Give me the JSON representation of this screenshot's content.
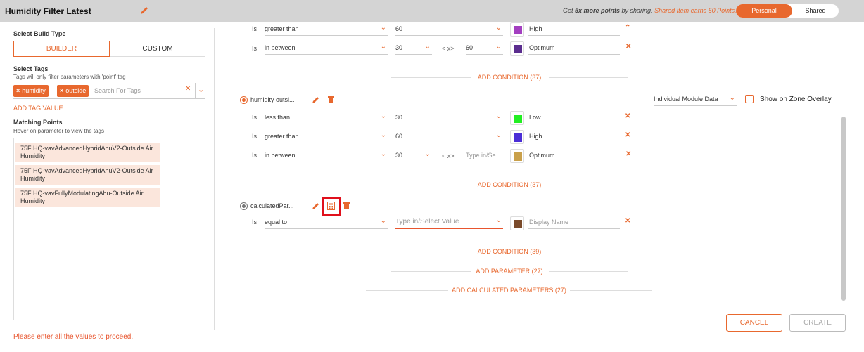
{
  "header": {
    "title": "Humidity Filter Latest",
    "share_prefix": "Get ",
    "share_bold": "5x more points",
    "share_mid": " by sharing. ",
    "share_accent": "Shared Item earns 50 Points.",
    "toggle_personal": "Personal",
    "toggle_shared": "Shared",
    "toggle_active": "Personal"
  },
  "left": {
    "build_type_label": "Select Build Type",
    "builder_label": "BUILDER",
    "custom_label": "CUSTOM",
    "tags_label": "Select Tags",
    "tags_hint": "Tags will only filter parameters with 'point' tag",
    "chips": [
      "humidity",
      "outside"
    ],
    "search_placeholder": "Search For Tags",
    "add_tag": "ADD TAG VALUE",
    "matching_label": "Matching Points",
    "matching_hint": "Hover on parameter to view the tags",
    "points": [
      "75F HQ-vavAdvancedHybridAhuV2-Outside Air Humidity",
      "75F HQ-vavAdvancedHybridAhuV2-Outside Air Humidity",
      "75F HQ-vavFullyModulatingAhu-Outside Air Humidity"
    ],
    "error": "Please enter all the values to proceed."
  },
  "block0": {
    "rows": [
      {
        "is": "Is",
        "op": "greater than",
        "v1": "60",
        "color": "#a33fc0",
        "name": "High"
      },
      {
        "is": "Is",
        "op": "in between",
        "v1": "30",
        "mid": "< x>",
        "v2": "60",
        "color": "#5b2d8e",
        "name": "Optimum"
      }
    ],
    "add_condition": "ADD CONDITION (37)"
  },
  "block1": {
    "param": "humidity outsi...",
    "rows": [
      {
        "is": "Is",
        "op": "less than",
        "v1": "30",
        "color": "#22ee22",
        "name": "Low"
      },
      {
        "is": "Is",
        "op": "greater than",
        "v1": "60",
        "color": "#4b2ed6",
        "name": "High"
      },
      {
        "is": "Is",
        "op": "in between",
        "v1": "30",
        "mid": "< x>",
        "v2": "Type in/Se",
        "color": "#c9a04a",
        "name": "Optimum"
      }
    ],
    "add_condition": "ADD CONDITION (37)"
  },
  "block2": {
    "param": "calculatedPar...",
    "rows": [
      {
        "is": "Is",
        "op": "equal to",
        "v1": "Type in/Select Value",
        "color": "#7a4a2a",
        "name": "Display Name"
      }
    ],
    "add_condition": "ADD CONDITION (39)"
  },
  "add_parameter": "ADD PARAMETER (27)",
  "add_calculated": "ADD CALCULATED PARAMETERS (27)",
  "module_select": "Individual Module Data",
  "overlay_label": "Show on Zone Overlay",
  "cancel": "CANCEL",
  "create": "CREATE",
  "colors": {
    "accent": "#e8682e",
    "highlight": "#e0101c"
  },
  "icons": [
    "pencil-icon",
    "trash-icon",
    "calculator-icon",
    "chevron-down-icon",
    "chevron-up-icon",
    "close-icon"
  ]
}
